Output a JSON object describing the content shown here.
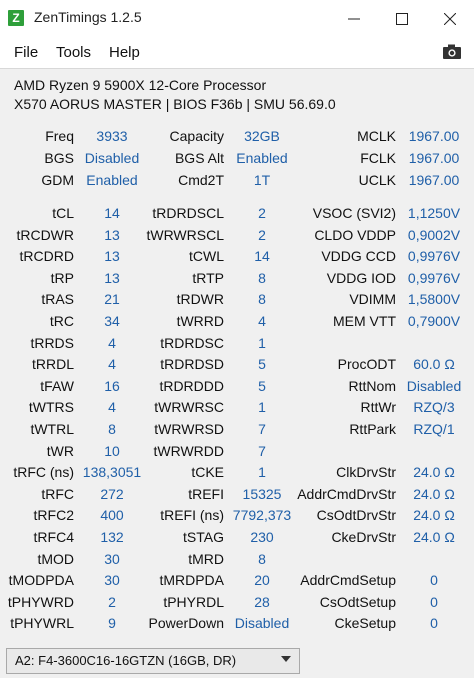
{
  "window": {
    "title": "ZenTimings 1.2.5",
    "icon_letter": "Z"
  },
  "menu": {
    "file": "File",
    "tools": "Tools",
    "help": "Help"
  },
  "cpu": {
    "name": "AMD Ryzen 9 5900X 12-Core Processor",
    "board": "X570 AORUS MASTER | BIOS F36b | SMU 56.69.0"
  },
  "row1": [
    {
      "l1": "Freq",
      "v1": "3933",
      "l2": "Capacity",
      "v2": "32GB",
      "l3": "MCLK",
      "v3": "1967.00"
    },
    {
      "l1": "BGS",
      "v1": "Disabled",
      "l2": "BGS Alt",
      "v2": "Enabled",
      "l3": "FCLK",
      "v3": "1967.00"
    },
    {
      "l1": "GDM",
      "v1": "Enabled",
      "l2": "Cmd2T",
      "v2": "1T",
      "l3": "UCLK",
      "v3": "1967.00"
    }
  ],
  "timings": [
    {
      "l1": "tCL",
      "v1": "14",
      "l2": "tRDRDSCL",
      "v2": "2",
      "l3": "VSOC (SVI2)",
      "v3": "1,1250V"
    },
    {
      "l1": "tRCDWR",
      "v1": "13",
      "l2": "tWRWRSCL",
      "v2": "2",
      "l3": "CLDO VDDP",
      "v3": "0,9002V"
    },
    {
      "l1": "tRCDRD",
      "v1": "13",
      "l2": "tCWL",
      "v2": "14",
      "l3": "VDDG CCD",
      "v3": "0,9976V"
    },
    {
      "l1": "tRP",
      "v1": "13",
      "l2": "tRTP",
      "v2": "8",
      "l3": "VDDG IOD",
      "v3": "0,9976V"
    },
    {
      "l1": "tRAS",
      "v1": "21",
      "l2": "tRDWR",
      "v2": "8",
      "l3": "VDIMM",
      "v3": "1,5800V"
    },
    {
      "l1": "tRC",
      "v1": "34",
      "l2": "tWRRD",
      "v2": "4",
      "l3": "MEM VTT",
      "v3": "0,7900V"
    },
    {
      "l1": "tRRDS",
      "v1": "4",
      "l2": "tRDRDSC",
      "v2": "1",
      "l3": "",
      "v3": ""
    },
    {
      "l1": "tRRDL",
      "v1": "4",
      "l2": "tRDRDSD",
      "v2": "5",
      "l3": "ProcODT",
      "v3": "60.0 Ω"
    },
    {
      "l1": "tFAW",
      "v1": "16",
      "l2": "tRDRDDD",
      "v2": "5",
      "l3": "RttNom",
      "v3": "Disabled"
    },
    {
      "l1": "tWTRS",
      "v1": "4",
      "l2": "tWRWRSC",
      "v2": "1",
      "l3": "RttWr",
      "v3": "RZQ/3"
    },
    {
      "l1": "tWTRL",
      "v1": "8",
      "l2": "tWRWRSD",
      "v2": "7",
      "l3": "RttPark",
      "v3": "RZQ/1"
    },
    {
      "l1": "tWR",
      "v1": "10",
      "l2": "tWRWRDD",
      "v2": "7",
      "l3": "",
      "v3": ""
    },
    {
      "l1": "tRFC (ns)",
      "v1": "138,3051",
      "l2": "tCKE",
      "v2": "1",
      "l3": "ClkDrvStr",
      "v3": "24.0 Ω"
    },
    {
      "l1": "tRFC",
      "v1": "272",
      "l2": "tREFI",
      "v2": "15325",
      "l3": "AddrCmdDrvStr",
      "v3": "24.0 Ω"
    },
    {
      "l1": "tRFC2",
      "v1": "400",
      "l2": "tREFI (ns)",
      "v2": "7792,373",
      "l3": "CsOdtDrvStr",
      "v3": "24.0 Ω"
    },
    {
      "l1": "tRFC4",
      "v1": "132",
      "l2": "tSTAG",
      "v2": "230",
      "l3": "CkeDrvStr",
      "v3": "24.0 Ω"
    },
    {
      "l1": "tMOD",
      "v1": "30",
      "l2": "tMRD",
      "v2": "8",
      "l3": "",
      "v3": ""
    },
    {
      "l1": "tMODPDA",
      "v1": "30",
      "l2": "tMRDPDA",
      "v2": "20",
      "l3": "AddrCmdSetup",
      "v3": "0"
    },
    {
      "l1": "tPHYWRD",
      "v1": "2",
      "l2": "tPHYRDL",
      "v2": "28",
      "l3": "CsOdtSetup",
      "v3": "0"
    },
    {
      "l1": "tPHYWRL",
      "v1": "9",
      "l2": "PowerDown",
      "v2": "Disabled",
      "l3": "CkeSetup",
      "v3": "0"
    }
  ],
  "dimm": {
    "selected": "A2: F4-3600C16-16GTZN (16GB, DR)"
  },
  "colors": {
    "value": "#1f5fa8",
    "accent_icon": "#2e9f3a",
    "panel_bg": "#f0f0f0"
  }
}
